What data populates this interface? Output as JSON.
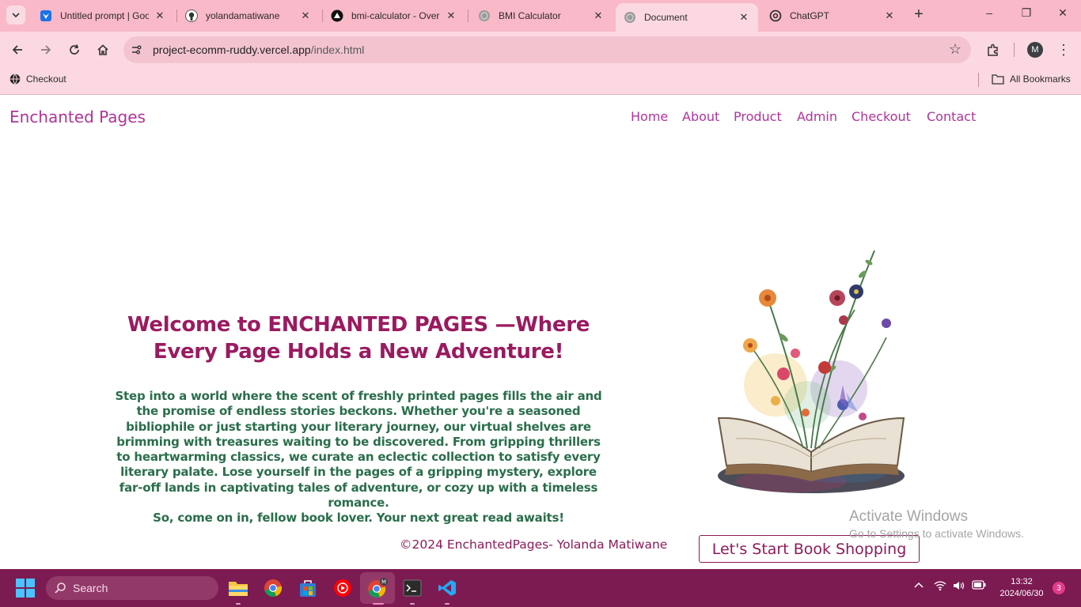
{
  "browser": {
    "tabs": [
      {
        "title": "Untitled prompt | Goo",
        "icon": "google-ai-studio-icon"
      },
      {
        "title": "yolandamatiwane",
        "icon": "github-icon"
      },
      {
        "title": "bmi-calculator - Over",
        "icon": "vercel-icon"
      },
      {
        "title": "BMI Calculator",
        "icon": "globe-icon"
      },
      {
        "title": "Document",
        "icon": "globe-icon",
        "active": true
      },
      {
        "title": "ChatGPT",
        "icon": "chatgpt-icon"
      }
    ],
    "new_tab": "+",
    "window_controls": {
      "minimize": "–",
      "restore": "❐",
      "close": "✕"
    },
    "address": {
      "host": "project-ecomm-ruddy.vercel.app",
      "path": "/index.html"
    },
    "profile_initial": "M",
    "bookmarks": [
      {
        "label": "Checkout",
        "icon": "globe-icon"
      }
    ],
    "all_bookmarks": "All Bookmarks"
  },
  "site": {
    "brand": "Enchanted Pages",
    "nav": [
      "Home",
      "About",
      "Product",
      "Admin",
      "Checkout",
      "Contact"
    ],
    "hero_title": "Welcome to ENCHANTED PAGES —Where Every Page Holds a New Adventure!",
    "hero_paragraph": "Step into a world where the scent of freshly printed pages fills the air and the promise of endless stories beckons. Whether you're a seasoned bibliophile or just starting your literary journey, our virtual shelves are brimming with treasures waiting to be discovered. From gripping thrillers to heartwarming classics, we curate an eclectic collection to satisfy every literary palate. Lose yourself in the pages of a gripping mystery, explore far-off lands in captivating tales of adventure, or cozy up with a timeless romance.",
    "hero_closing": "So, come on in, fellow book lover. Your next great read awaits!",
    "footer": "©2024 EnchantedPages- Yolanda Matiwane",
    "cta_button": "Let's Start Book Shopping",
    "image": "open-book-with-flowers-illustration"
  },
  "watermark": {
    "line1": "Activate Windows",
    "line2": "Go to Settings to activate Windows."
  },
  "taskbar": {
    "search_label": "Search",
    "apps": [
      "windows-start-icon",
      "file-explorer-icon",
      "chrome-icon",
      "microsoft-store-icon",
      "youtube-music-icon",
      "chrome-profile-icon",
      "terminal-icon",
      "vscode-icon"
    ],
    "time": "13:32",
    "date": "2024/06/30",
    "notifications": "3"
  },
  "colors": {
    "chrome_pink": "#f9b9c8",
    "brand_magenta": "#b1339a",
    "title_maroon": "#9a1a60",
    "text_green": "#2a6e4a",
    "taskbar": "#7c1a52"
  }
}
